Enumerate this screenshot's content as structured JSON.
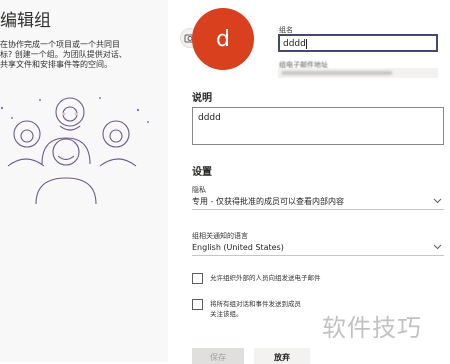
{
  "left_panel": {
    "heading": "编辑组",
    "intro_lines": [
      "在协作完成一个项目或一个共同目",
      "标? 创建一个组。为团队提供对话、",
      "共享文件和安排事件等的空间。"
    ]
  },
  "avatar": {
    "initial": "d",
    "color": "#d9411e",
    "camera_icon": "camera-icon"
  },
  "name": {
    "label": "组名",
    "value": "dddd"
  },
  "email": {
    "label": "组电子邮件地址"
  },
  "description": {
    "title": "说明",
    "value": "dddd"
  },
  "settings": {
    "title": "设置",
    "privacy_label": "隐私",
    "privacy_value": "专用 - 仅获得批准的成员可以查看内部内容",
    "language_label": "组相关通知的语言",
    "language_value": "English (United States)",
    "allow_external_label": "允许组织外部的人员向组发送电子邮件",
    "send_copies_line1": "将所有组对话和事件发送到成员",
    "send_copies_line2": "关注该组。"
  },
  "buttons": {
    "save": "保存",
    "discard": "放弃"
  },
  "watermark": "软件技巧",
  "colors": {
    "accent": "#464775",
    "avatar": "#d9411e"
  }
}
